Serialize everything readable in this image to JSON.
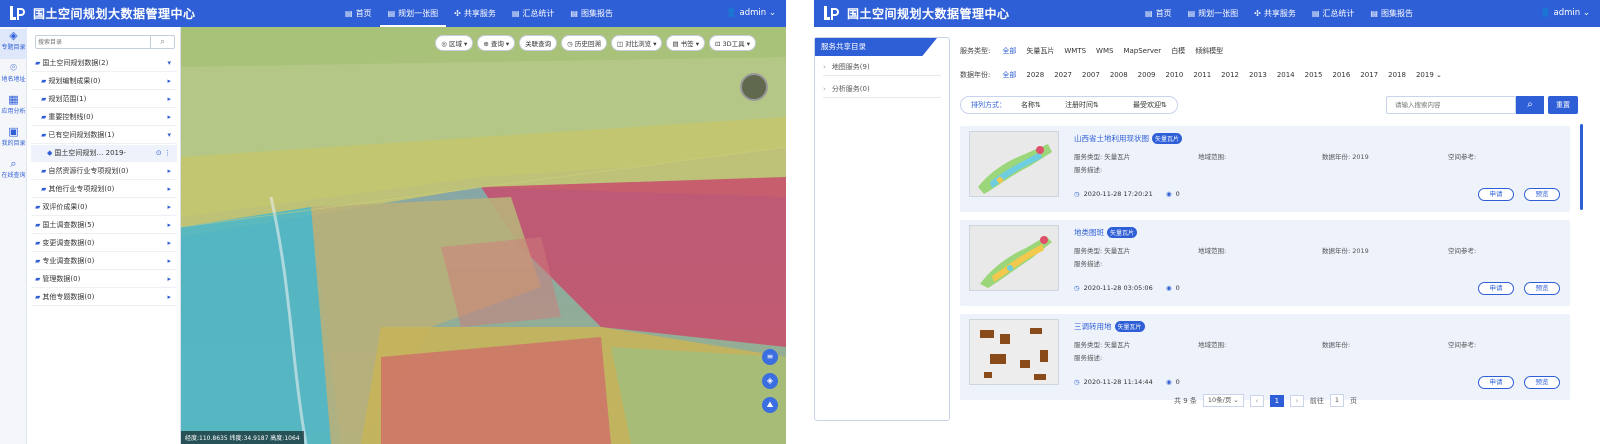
{
  "app": {
    "title": "国土空间规划大数据管理中心",
    "user": "admin ⌄"
  },
  "nav": [
    {
      "label": "首页",
      "icon": "home-icon"
    },
    {
      "label": "规划一张图",
      "icon": "map-icon"
    },
    {
      "label": "共享服务",
      "icon": "share-icon"
    },
    {
      "label": "汇总统计",
      "icon": "stats-icon"
    },
    {
      "label": "图集报告",
      "icon": "atlas-icon"
    }
  ],
  "left": {
    "side_icons": [
      {
        "label": "专题目录"
      },
      {
        "label": "地名地址"
      },
      {
        "label": "应用分析"
      },
      {
        "label": "我的目录"
      },
      {
        "label": "在线查询"
      }
    ],
    "search_placeholder": "搜索目录",
    "tree": [
      {
        "label": "国土空间规划数据(2)",
        "indent": 0,
        "arrow": "▾"
      },
      {
        "label": "规划编制成果(0)",
        "indent": 1,
        "arrow": "▸"
      },
      {
        "label": "规划范围(1)",
        "indent": 1,
        "arrow": "▸"
      },
      {
        "label": "重要控制线(0)",
        "indent": 1,
        "arrow": "▸"
      },
      {
        "label": "已有空间规划数据(1)",
        "indent": 1,
        "arrow": "▾"
      },
      {
        "label": "国土空间规划…  2019-",
        "indent": 2,
        "arrow": "⊙ ⋮"
      },
      {
        "label": "自然资源行业专项规划(0)",
        "indent": 1,
        "arrow": "▸"
      },
      {
        "label": "其他行业专项规划(0)",
        "indent": 1,
        "arrow": "▸"
      },
      {
        "label": "双评价成果(0)",
        "indent": 0,
        "arrow": "▸"
      },
      {
        "label": "国土调查数据(5)",
        "indent": 0,
        "arrow": "▸"
      },
      {
        "label": "变更调查数据(0)",
        "indent": 0,
        "arrow": "▸"
      },
      {
        "label": "专业调查数据(0)",
        "indent": 0,
        "arrow": "▸"
      },
      {
        "label": "管理数据(0)",
        "indent": 0,
        "arrow": "▸"
      },
      {
        "label": "其他专题数据(0)",
        "indent": 0,
        "arrow": "▸"
      }
    ],
    "map_tools": [
      "◎ 区域 ▾",
      "⊕ 查询 ▾",
      "关联查询",
      "◷ 历史回溯",
      "◫ 对比浏览 ▾",
      "▤ 书签 ▾",
      "⊡ 3D工具 ▾"
    ],
    "coord_text": "经度:110.8635 纬度:34.9187 高度:1064"
  },
  "right": {
    "sidebar_head": "服务共享目录",
    "sidebar_items": [
      "地图服务(9)",
      "分析服务(0)"
    ],
    "filter_type_label": "服务类型:",
    "filter_types": [
      "全部",
      "矢量瓦片",
      "WMTS",
      "WMS",
      "MapServer",
      "白模",
      "倾斜模型"
    ],
    "filter_year_label": "数据年份:",
    "filter_years": [
      "全部",
      "2028",
      "2027",
      "2007",
      "2008",
      "2009",
      "2010",
      "2011",
      "2012",
      "2013",
      "2014",
      "2015",
      "2016",
      "2017",
      "2018",
      "2019 ⌄"
    ],
    "sort_label": "排列方式：",
    "sort_items": [
      "名称⇅",
      "注册时间⇅",
      "最受欢迎⇅"
    ],
    "search_placeholder": "请输入搜索内容",
    "reset_label": "重置",
    "cards": [
      {
        "title": "山西省土地利用现状图",
        "badge": "矢量瓦片",
        "type": "服务类型: 矢量瓦片",
        "range": "地域范围:",
        "year": "数据年份: 2019",
        "ref": "空间参考:",
        "desc": "服务描述:",
        "time": "2020-11-28 17:20:21",
        "views": "0",
        "apply": "申请",
        "preview": "预览"
      },
      {
        "title": "地类图斑",
        "badge": "矢量瓦片",
        "type": "服务类型: 矢量瓦片",
        "range": "地域范围:",
        "year": "数据年份: 2019",
        "ref": "空间参考:",
        "desc": "服务描述:",
        "time": "2020-11-28 03:05:06",
        "views": "0",
        "apply": "申请",
        "preview": "预览"
      },
      {
        "title": "三调转用地",
        "badge": "矢量瓦片",
        "type": "服务类型: 矢量瓦片",
        "range": "地域范围:",
        "year": "数据年份:",
        "ref": "空间参考:",
        "desc": "服务描述:",
        "time": "2020-11-28 11:14:44",
        "views": "0",
        "apply": "申请",
        "preview": "预览"
      }
    ],
    "pager": {
      "total": "共 9 条",
      "size": "10条/页 ⌄",
      "current": "1",
      "goto": "前往",
      "goto_val": "1",
      "page_suffix": "页"
    }
  },
  "colors": {
    "accent": "#2f5fd6"
  }
}
